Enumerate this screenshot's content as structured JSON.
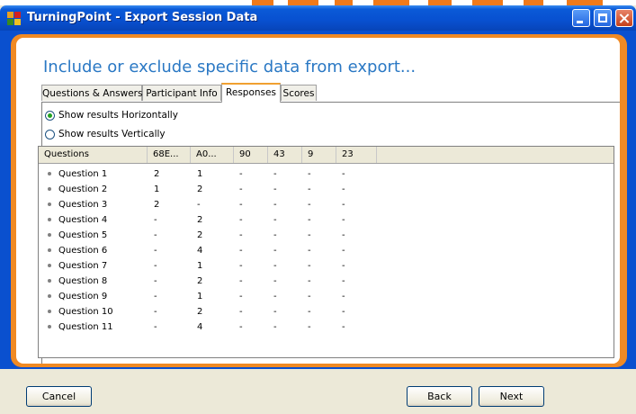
{
  "window": {
    "title": "TurningPoint - Export Session Data"
  },
  "heading": "Include or exclude specific data from export...",
  "tabs": [
    {
      "label": "Questions & Answers"
    },
    {
      "label": "Participant Info"
    },
    {
      "label": "Responses"
    },
    {
      "label": "Scores"
    }
  ],
  "active_tab": "Responses",
  "options": {
    "horizontal": "Show results Horizontally",
    "vertical": "Show results Vertically",
    "selected": "horizontal"
  },
  "table": {
    "columns": [
      "Questions",
      "68E...",
      "A0...",
      "90",
      "43",
      "9",
      "23"
    ],
    "rows": [
      [
        "Question 1",
        "2",
        "1",
        "-",
        "-",
        "-",
        "-"
      ],
      [
        "Question 2",
        "1",
        "2",
        "-",
        "-",
        "-",
        "-"
      ],
      [
        "Question 3",
        "2",
        "-",
        "-",
        "-",
        "-",
        "-"
      ],
      [
        "Question 4",
        "-",
        "2",
        "-",
        "-",
        "-",
        "-"
      ],
      [
        "Question 5",
        "-",
        "2",
        "-",
        "-",
        "-",
        "-"
      ],
      [
        "Question 6",
        "-",
        "4",
        "-",
        "-",
        "-",
        "-"
      ],
      [
        "Question 7",
        "-",
        "1",
        "-",
        "-",
        "-",
        "-"
      ],
      [
        "Question 8",
        "-",
        "2",
        "-",
        "-",
        "-",
        "-"
      ],
      [
        "Question 9",
        "-",
        "1",
        "-",
        "-",
        "-",
        "-"
      ],
      [
        "Question 10",
        "-",
        "2",
        "-",
        "-",
        "-",
        "-"
      ],
      [
        "Question 11",
        "-",
        "4",
        "-",
        "-",
        "-",
        "-"
      ]
    ]
  },
  "buttons": {
    "cancel": "Cancel",
    "back": "Back",
    "next": "Next"
  },
  "colors": {
    "titlebar": "#0a50cf",
    "accent_orange": "#f08a24",
    "heading_blue": "#2a78c4",
    "radio_selected": "#21a121"
  }
}
